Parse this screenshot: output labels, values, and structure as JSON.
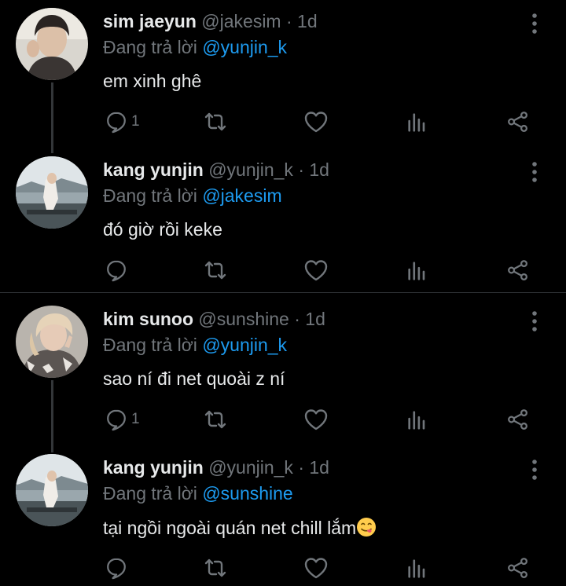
{
  "colors": {
    "background": "#000000",
    "text": "#e7e9ea",
    "muted": "#71767b",
    "mention": "#1d9bf0",
    "divider": "#2f3336"
  },
  "tweets": [
    {
      "name": "sim jaeyun",
      "handle": "@jakesim",
      "sep": "·",
      "time": "1d",
      "reply_prefix": "Đang trả lời",
      "reply_to": "@yunjin_k",
      "text": "em xinh ghê",
      "reply_count": "1"
    },
    {
      "name": "kang yunjin",
      "handle": "@yunjin_k",
      "sep": "·",
      "time": "1d",
      "reply_prefix": "Đang trả lời",
      "reply_to": "@jakesim",
      "text": "đó giờ rồi keke",
      "reply_count": ""
    },
    {
      "name": "kim sunoo",
      "handle": "@sunshine",
      "sep": "·",
      "time": "1d",
      "reply_prefix": "Đang trả lời",
      "reply_to": "@yunjin_k",
      "text": "sao ní đi net quoài z ní",
      "reply_count": "1"
    },
    {
      "name": "kang yunjin",
      "handle": "@yunjin_k",
      "sep": "·",
      "time": "1d",
      "reply_prefix": "Đang trả lời",
      "reply_to": "@sunshine",
      "text": "tại ngồi ngoài quán net chill lắm",
      "reply_count": "",
      "emoji": "face-savoring-food-emoji"
    }
  ],
  "icons": {
    "reply": "reply-icon",
    "retweet": "retweet-icon",
    "like": "heart-icon",
    "views": "views-icon",
    "share": "share-icon",
    "more": "more-vertical-icon"
  }
}
